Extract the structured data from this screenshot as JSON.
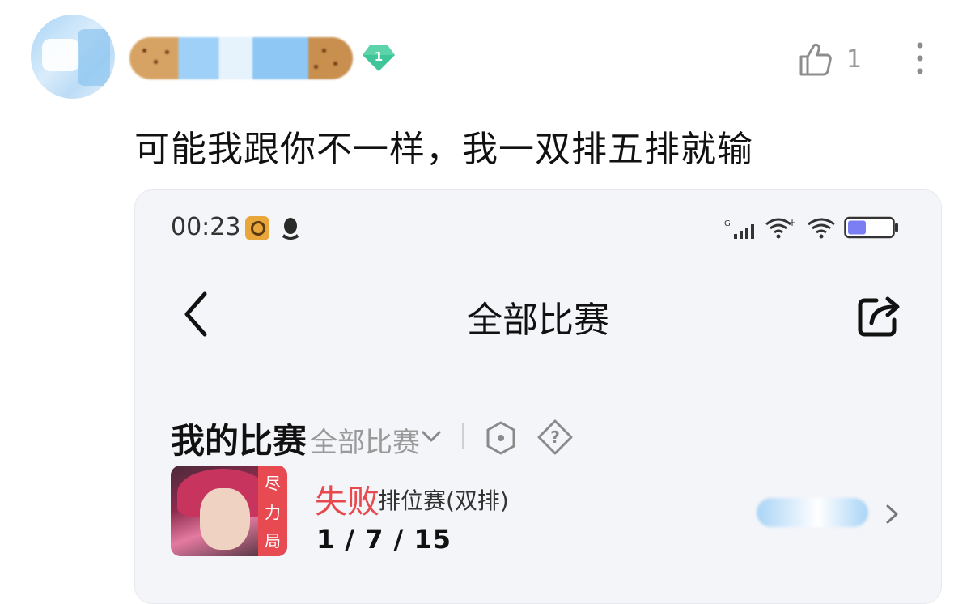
{
  "post": {
    "avatar_icon": "user-avatar",
    "level_badge": "1",
    "like_count": "1",
    "like_icon": "thumbs-up-icon",
    "more_icon": "vertical-ellipsis-icon",
    "comment_text": "可能我跟你不一样，我一双排五排就输"
  },
  "screenshot": {
    "status_bar": {
      "time": "00:23",
      "battery_color": "#7b7ef2"
    },
    "nav": {
      "title": "全部比赛",
      "back_icon": "chevron-left-icon",
      "share_icon": "share-icon"
    },
    "section": {
      "title": "我的比赛",
      "filter_label": "全部比赛"
    },
    "match": {
      "tag": [
        "尽",
        "力",
        "局"
      ],
      "result": "失败",
      "type": "排位赛(双排)",
      "kda": "1 / 7 / 15",
      "result_color": "#e7494c"
    }
  }
}
